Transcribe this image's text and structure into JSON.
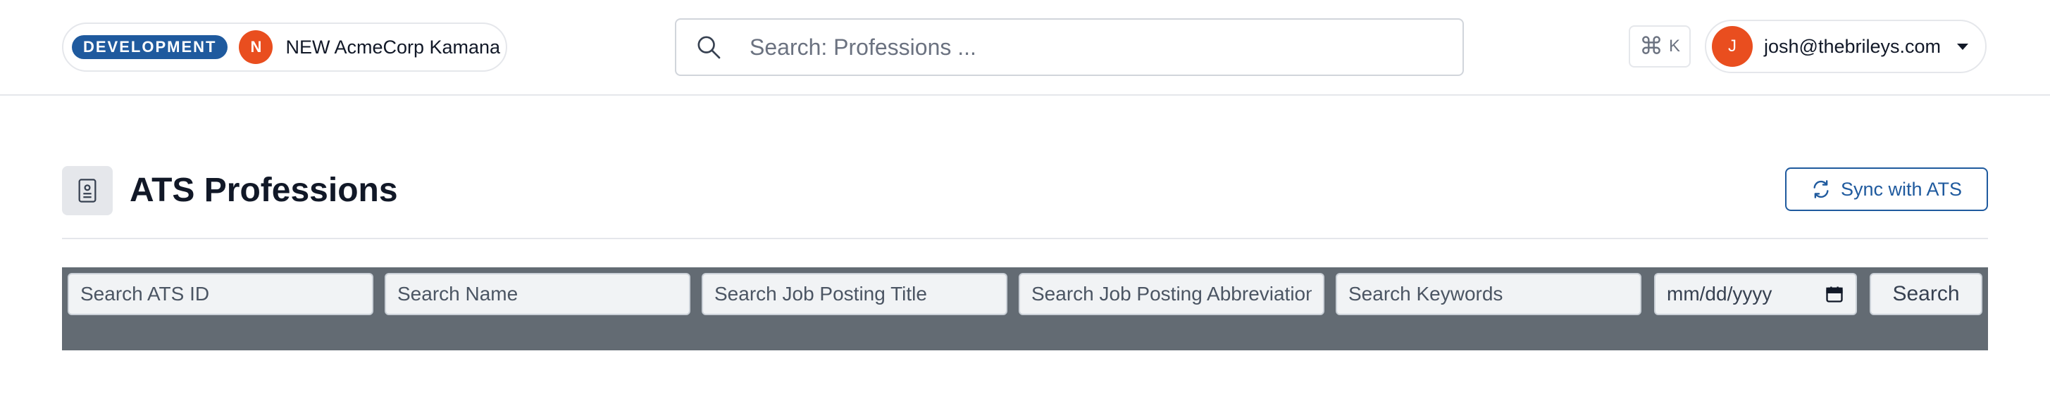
{
  "topbar": {
    "environment_badge": "DEVELOPMENT",
    "tenant": {
      "avatar_letter": "N",
      "name": "NEW AcmeCorp Kamana"
    },
    "search": {
      "placeholder": "Search: Professions ..."
    },
    "shortcut": {
      "symbol": "⌘",
      "key": "K"
    },
    "user": {
      "avatar_letter": "J",
      "email": "josh@thebrileys.com"
    }
  },
  "page": {
    "title": "ATS Professions",
    "sync_button_label": "Sync with ATS"
  },
  "filters": {
    "ats_id_placeholder": "Search ATS ID",
    "name_placeholder": "Search Name",
    "job_posting_title_placeholder": "Search Job Posting Title",
    "job_posting_abbreviation_placeholder": "Search Job Posting Abbreviation",
    "keywords_placeholder": "Search Keywords",
    "date_placeholder": "mm/dd/yyyy",
    "search_button_label": "Search"
  },
  "colors": {
    "brand_blue": "#1f5a9e",
    "avatar_orange": "#e94e1f",
    "filter_bar_bg": "#636b73"
  },
  "icons": {
    "global_search": "search-icon",
    "page": "contact-card-icon",
    "sync": "refresh-icon",
    "date": "calendar-icon",
    "user_menu": "chevron-down-icon"
  }
}
